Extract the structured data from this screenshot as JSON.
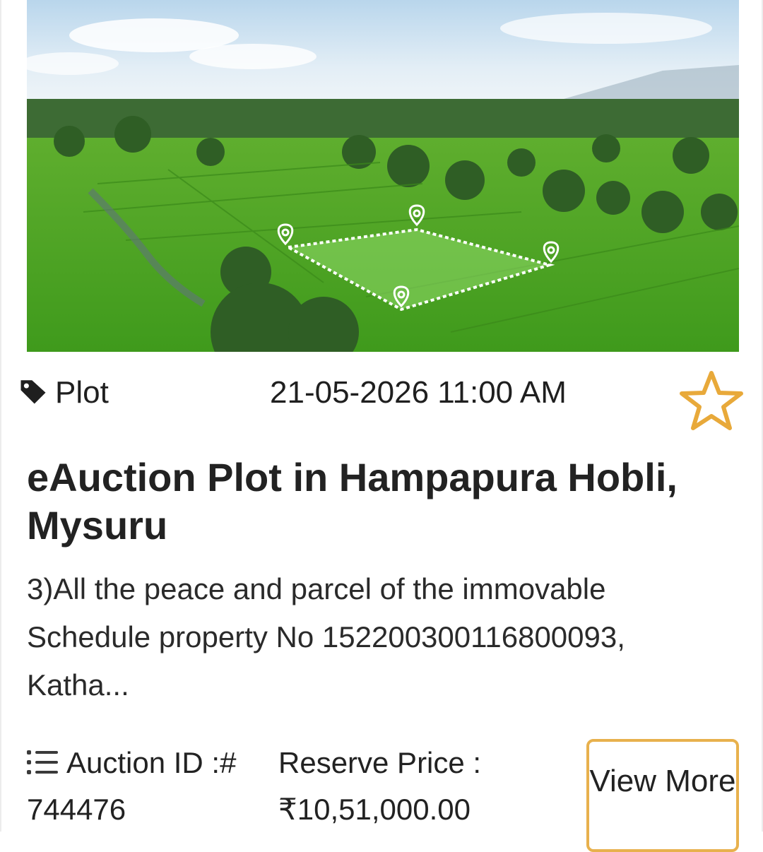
{
  "listing": {
    "category": "Plot",
    "auction_datetime": "21-05-2026 11:00 AM",
    "title": "eAuction Plot in Hampapura Hobli, Mysuru",
    "description": "3)All the peace and parcel of the immovable Schedule property No 152200300116800093, Katha...",
    "auction_id_label": "Auction ID :#",
    "auction_id_value": "744476",
    "reserve_price_label": "Reserve Price :",
    "reserve_price_value": "₹10,51,000.00",
    "view_more_label": "View More"
  },
  "icons": {
    "tag": "tag-icon",
    "favorite": "star-outline-icon",
    "details": "list-icon"
  },
  "colors": {
    "accent": "#e8a93a",
    "text": "#1f1f1f"
  }
}
